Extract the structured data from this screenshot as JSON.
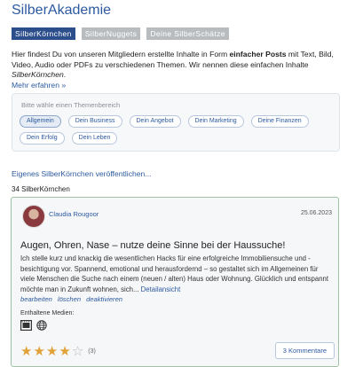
{
  "app": {
    "title": "SilberAkademie"
  },
  "tabs": [
    {
      "label": "SilberKörnchen"
    },
    {
      "label": "SilberNuggets"
    },
    {
      "label": "Deine SilberSchätze"
    }
  ],
  "intro": {
    "part1": "Hier findest Du von unseren Mitgliedern erstellte Inhalte in Form ",
    "bold": "einfacher Posts",
    "part2": " mit Text, Bild, Video, Audio oder PDFs zu verschiedenen Themen. Wir nennen diese einfachen Inhalte ",
    "italic": "SilberKörnchen",
    "part3": ".",
    "more_link": "Mehr erfahren »"
  },
  "themes": {
    "label": "Bitte wähle einen Themenbereich",
    "chips": [
      "Allgemein",
      "Dein Business",
      "Dein Angebot",
      "Dein Marketing",
      "Deine Finanzen",
      "Dein Erfolg",
      "Dein Leben"
    ]
  },
  "publish_link": "Eigenes SilberKörnchen veröffentlichen...",
  "count_label": "34 SilberKörnchen",
  "post": {
    "author": "Claudia Rougoor",
    "date": "25.06.2023",
    "title": "Augen, Ohren, Nase – nutze deine Sinne bei der Haussuche!",
    "body": "Ich stelle kurz und knackig die wesentlichen Hacks für eine erfolgreiche Immobiliensuche und - besichtigung vor. Spannend, emotional und herausfordernd – so gestaltet sich im Allgemeinen für viele Menschen die Suche nach einem (neuen / alten) Haus oder Wohnung. Glücklich und entspannt möchte man in Zukunft wohnen, sich... ",
    "detail_link": "Detailansicht",
    "actions": [
      "bearbeiten",
      "löschen",
      "deaktivieren"
    ],
    "media_label": "Enthaltene Medien:",
    "media_icons": [
      "video-icon",
      "globe-icon"
    ],
    "rating": {
      "value": 4,
      "max": 5,
      "count_label": "(3)"
    },
    "comments_label": "3 Kommentare"
  },
  "colors": {
    "link": "#2c5aa0",
    "active_tab": "#2c4f8c",
    "inactive_tab": "#b9bcbf",
    "card_border": "#9fc3a4",
    "star": "#e1a23a"
  }
}
